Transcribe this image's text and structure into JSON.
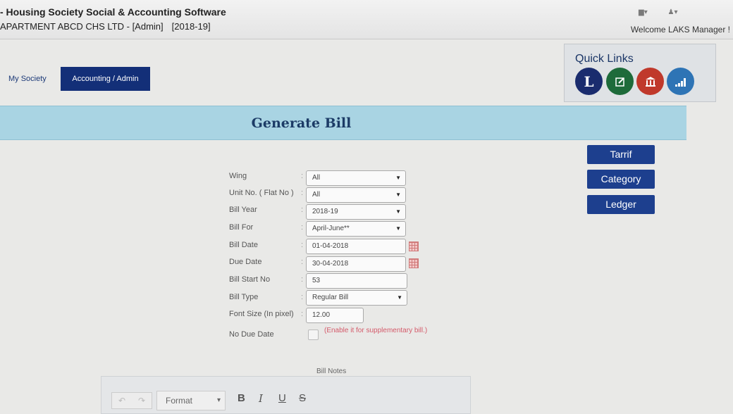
{
  "header": {
    "app_title": "- Housing Society Social & Accounting Software",
    "society": "APARTMENT ABCD CHS LTD - [Admin]",
    "year": "[2018-19]",
    "welcome": "Welcome LAKS Manager !",
    "icons": [
      "mail-icon",
      "user-icon"
    ]
  },
  "nav": {
    "my_society": "My Society",
    "accounting_admin": "Accounting / Admin"
  },
  "quick_links": {
    "title": "Quick Links",
    "items": [
      {
        "icon": "ledger-icon",
        "glyph": "L",
        "color": "#1a2c6e"
      },
      {
        "icon": "edit-icon",
        "glyph": "✎",
        "color": "#1e6b3a"
      },
      {
        "icon": "bank-icon",
        "glyph": "🏛",
        "color": "#c0392b"
      },
      {
        "icon": "bar-chart-icon",
        "glyph": "▂▄▆",
        "color": "#2e74b5"
      }
    ]
  },
  "page": {
    "title": "Generate Bill"
  },
  "side_buttons": {
    "tarrif": "Tarrif",
    "category": "Category",
    "ledger": "Ledger"
  },
  "form": {
    "wing": {
      "label": "Wing",
      "value": "All"
    },
    "unit": {
      "label": "Unit No. ( Flat No )",
      "value": "All"
    },
    "bill_year": {
      "label": "Bill Year",
      "value": "2018-19"
    },
    "bill_for": {
      "label": "Bill For",
      "value": "April-June**"
    },
    "bill_date": {
      "label": "Bill Date",
      "value": "01-04-2018"
    },
    "due_date": {
      "label": "Due Date",
      "value": "30-04-2018"
    },
    "bill_start_no": {
      "label": "Bill Start No",
      "value": "53"
    },
    "bill_type": {
      "label": "Bill Type",
      "value": "Regular Bill"
    },
    "font_size": {
      "label": "Font Size (In pixel)",
      "value": "12.00"
    },
    "no_due_date": {
      "label": "No Due Date",
      "note": "(Enable it for supplementary bill.)"
    }
  },
  "editor": {
    "notes_label": "Bill Notes",
    "format": "Format",
    "bold": "B",
    "italic": "I",
    "underline": "U",
    "strike": "S"
  }
}
